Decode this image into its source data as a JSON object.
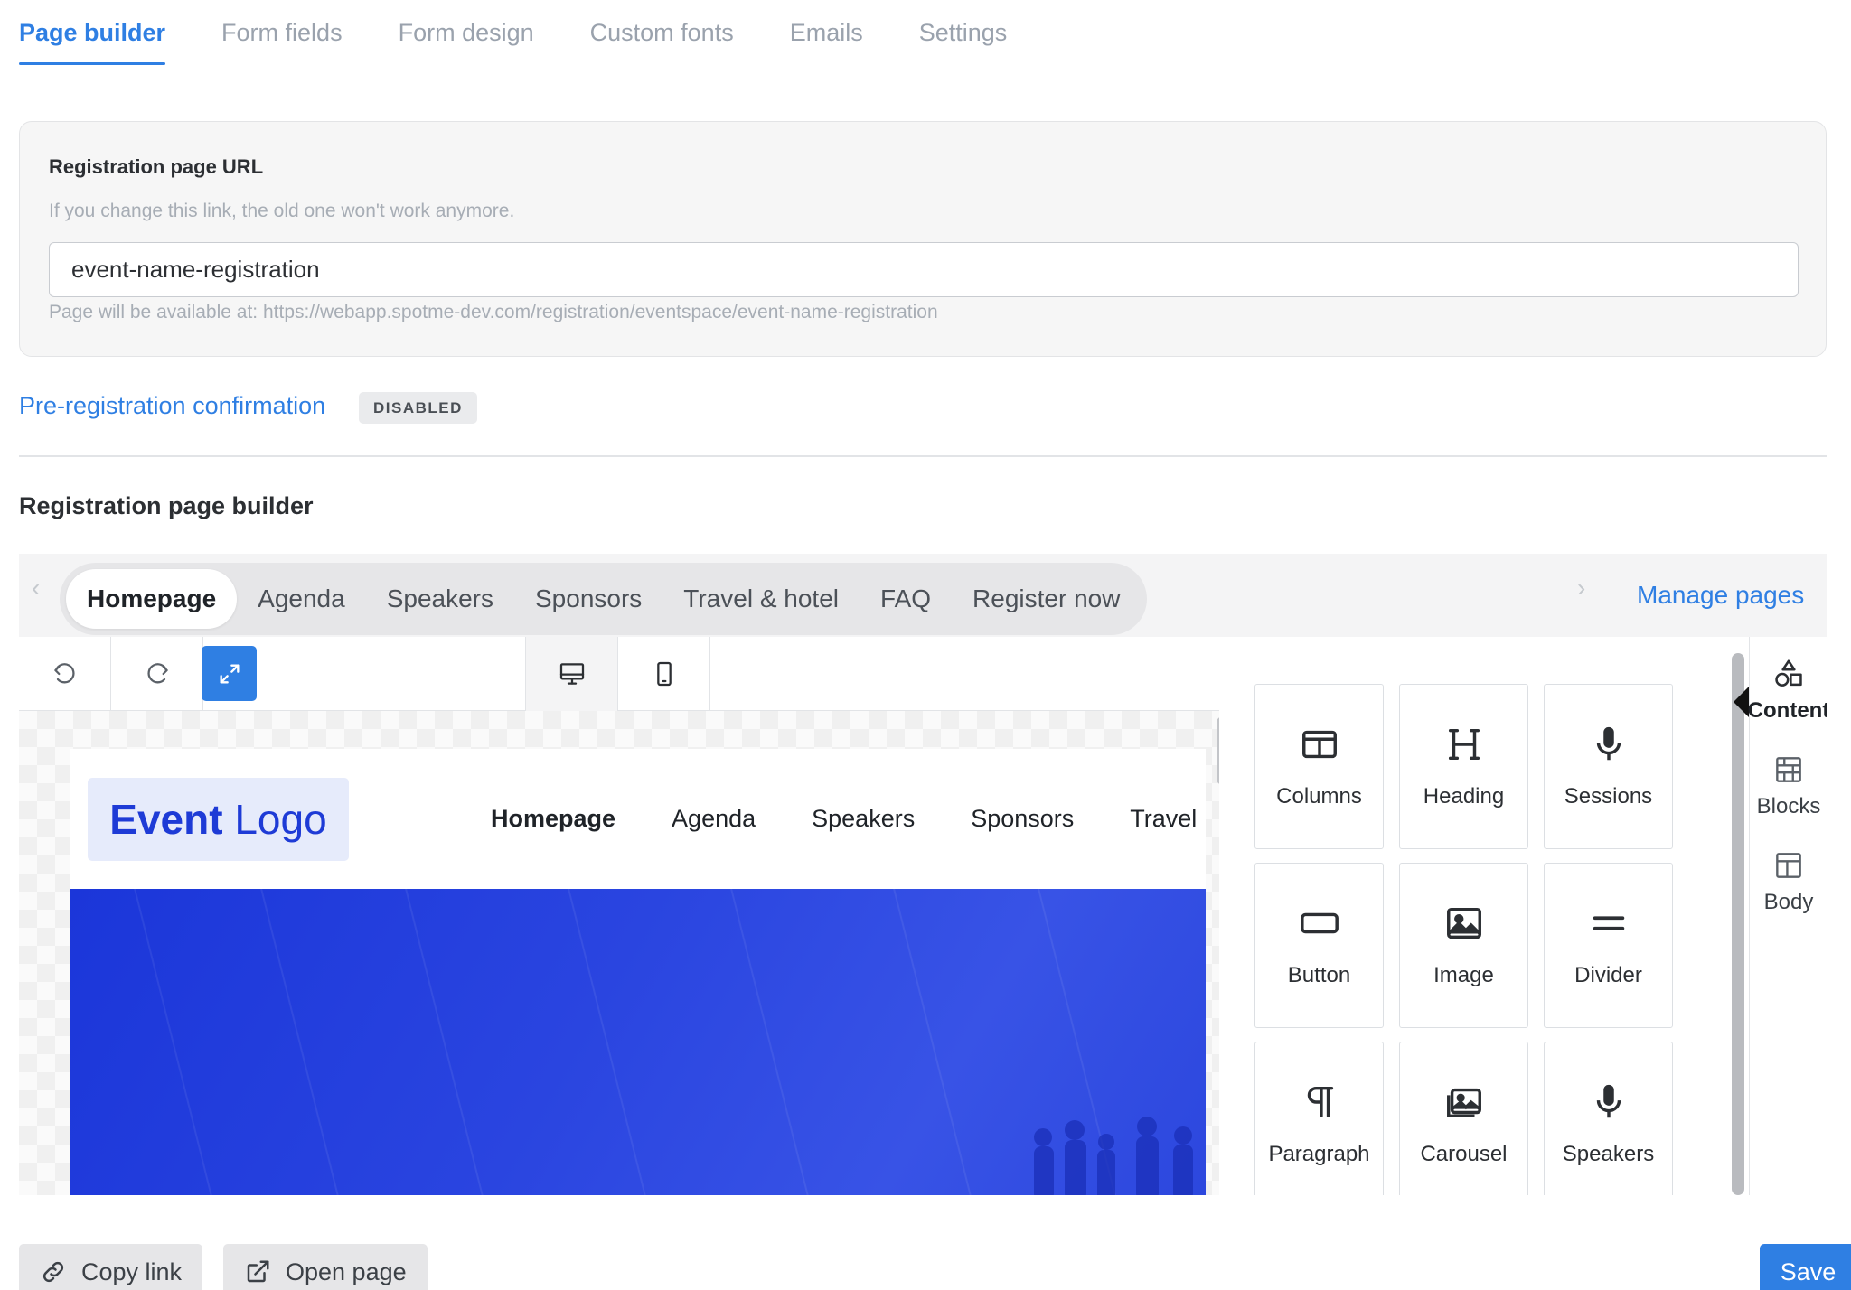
{
  "top_tabs": [
    {
      "label": "Page builder",
      "active": true
    },
    {
      "label": "Form fields",
      "active": false
    },
    {
      "label": "Form design",
      "active": false
    },
    {
      "label": "Custom fonts",
      "active": false
    },
    {
      "label": "Emails",
      "active": false
    },
    {
      "label": "Settings",
      "active": false
    }
  ],
  "url_card": {
    "title": "Registration page URL",
    "help": "If you change this link, the old one won't work anymore.",
    "value": "event-name-registration",
    "preview": "Page will be available at: https://webapp.spotme-dev.com/registration/eventspace/event-name-registration"
  },
  "prereg": {
    "link": "Pre-registration confirmation",
    "badge": "DISABLED"
  },
  "builder": {
    "title": "Registration page builder",
    "pages": [
      {
        "label": "Homepage",
        "active": true
      },
      {
        "label": "Agenda",
        "active": false
      },
      {
        "label": "Speakers",
        "active": false
      },
      {
        "label": "Sponsors",
        "active": false
      },
      {
        "label": "Travel & hotel",
        "active": false
      },
      {
        "label": "FAQ",
        "active": false
      },
      {
        "label": "Register now",
        "active": false
      }
    ],
    "manage_pages": "Manage pages",
    "toolbar_icons": [
      "undo-icon",
      "redo-icon",
      "expand-icon",
      "desktop-icon",
      "mobile-icon"
    ],
    "preview": {
      "logo_bold": "Event",
      "logo_rest": " Logo",
      "nav": [
        "Homepage",
        "Agenda",
        "Speakers",
        "Sponsors",
        "Travel"
      ]
    },
    "content_tiles": [
      {
        "label": "Columns",
        "icon": "columns-icon"
      },
      {
        "label": "Heading",
        "icon": "heading-icon"
      },
      {
        "label": "Sessions",
        "icon": "microphone-icon"
      },
      {
        "label": "Button",
        "icon": "button-icon"
      },
      {
        "label": "Image",
        "icon": "image-icon"
      },
      {
        "label": "Divider",
        "icon": "divider-icon"
      },
      {
        "label": "Paragraph",
        "icon": "paragraph-icon"
      },
      {
        "label": "Carousel",
        "icon": "carousel-icon"
      },
      {
        "label": "Speakers",
        "icon": "microphone-icon"
      }
    ],
    "side_nav": [
      {
        "label": "Content",
        "active": true,
        "icon": "shapes-icon"
      },
      {
        "label": "Blocks",
        "active": false,
        "icon": "blocks-icon"
      },
      {
        "label": "Body",
        "active": false,
        "icon": "layout-icon"
      }
    ]
  },
  "footer": {
    "copy_link": "Copy link",
    "open_page": "Open page",
    "save": "Save"
  },
  "colors": {
    "accent": "#2f7fe3",
    "logo_text": "#1e3bd6",
    "hero": "#2a45e0"
  }
}
